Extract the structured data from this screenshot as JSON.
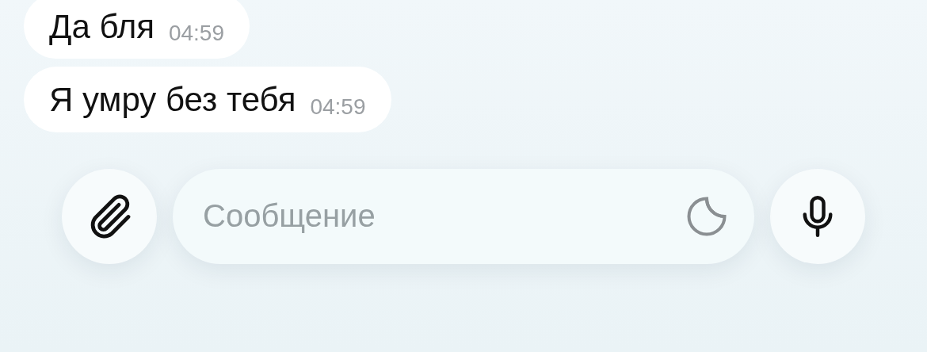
{
  "messages": [
    {
      "text": "Да бля",
      "time": "04:59"
    },
    {
      "text": "Я умру без тебя",
      "time": "04:59"
    }
  ],
  "composer": {
    "placeholder": "Сообщение"
  }
}
